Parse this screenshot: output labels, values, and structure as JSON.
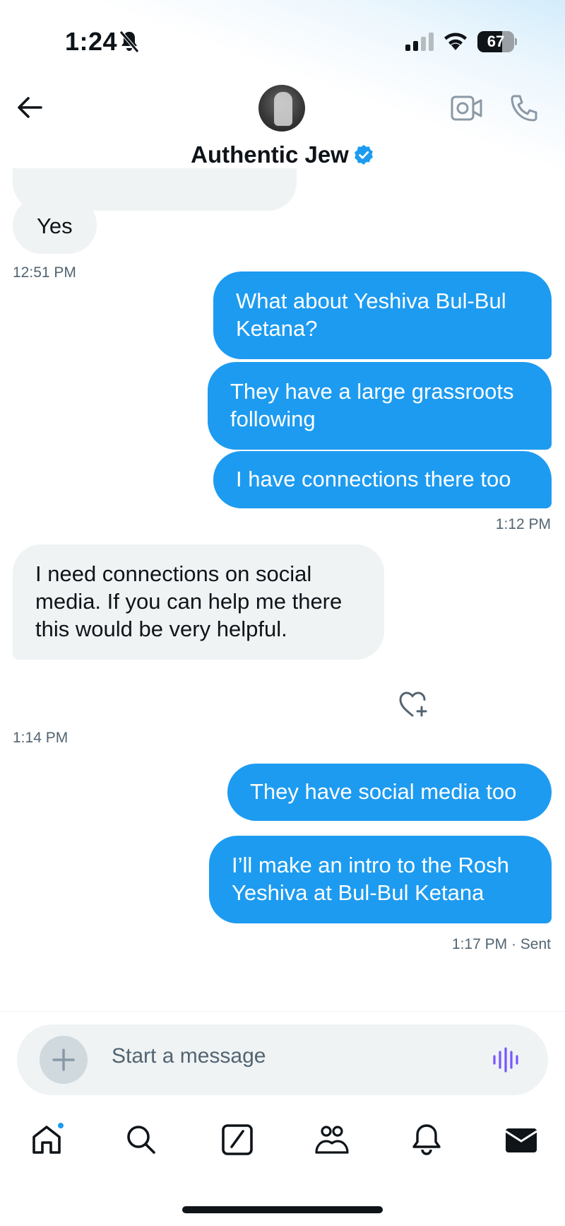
{
  "status_bar": {
    "time": "1:24",
    "battery": "67",
    "battery_level": 0.67
  },
  "header": {
    "contact_name": "Authentic Jew",
    "verified": true
  },
  "messages": [
    {
      "direction": "in",
      "text": "Yes"
    },
    {
      "timestamp": "12:51 PM"
    },
    {
      "direction": "out",
      "text": "What about Yeshiva Bul-Bul Ketana?"
    },
    {
      "direction": "out",
      "text": "They have a large grassroots following"
    },
    {
      "direction": "out",
      "text": "I have connections there too"
    },
    {
      "timestamp": "1:12 PM"
    },
    {
      "direction": "in",
      "text": "I need connections on social media. If you can help me there this would be very helpful."
    },
    {
      "timestamp": "1:14 PM"
    },
    {
      "direction": "out",
      "text": "They have social media too"
    },
    {
      "direction": "out",
      "text": "I’ll make an intro to the Rosh Yeshiva at Bul-Bul Ketana"
    },
    {
      "timestamp": "1:17 PM",
      "status": "· Sent"
    }
  ],
  "composer": {
    "placeholder": "Start a message"
  },
  "tabs": [
    "home-icon",
    "search-icon",
    "grok-icon",
    "communities-icon",
    "notifications-icon",
    "messages-icon"
  ],
  "colors": {
    "accent": "#1d9bf0",
    "incoming_bubble": "#eff3f4",
    "voice": "#7856ff"
  }
}
